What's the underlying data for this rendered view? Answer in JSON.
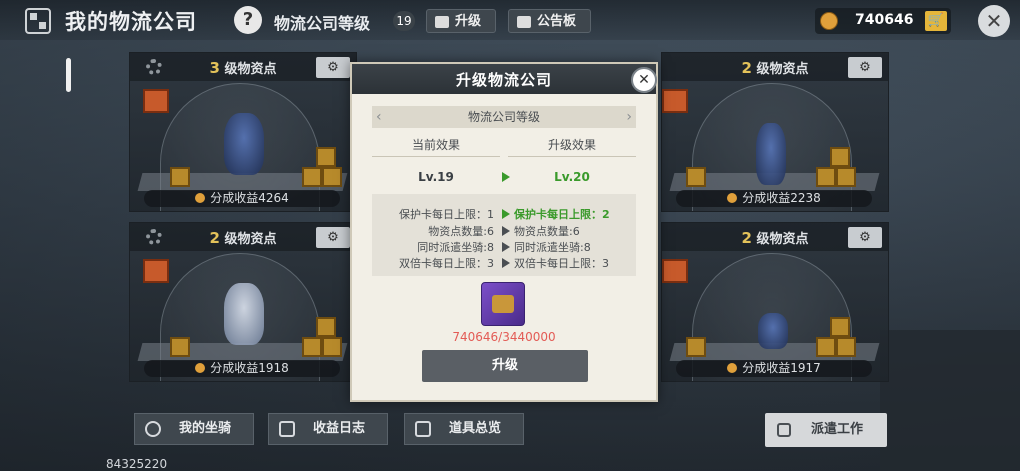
{
  "header": {
    "title": "我的物流公司",
    "help_label": "?",
    "level_label": "物流公司等级",
    "level_value": "19",
    "upgrade_label": "升级",
    "notice_label": "公告板",
    "coins": "740646",
    "close_label": "✕"
  },
  "cards": [
    {
      "level_num": "3",
      "title_suffix": "级物资点",
      "income": "分成收益4264"
    },
    {
      "level_num": "2",
      "title_suffix": "级物资点",
      "income": "分成收益2238"
    },
    {
      "level_num": "2",
      "title_suffix": "级物资点",
      "income": "分成收益1918"
    },
    {
      "level_num": "2",
      "title_suffix": "级物资点",
      "income": "分成收益1917"
    }
  ],
  "bottom": {
    "my_mounts": "我的坐骑",
    "income_log": "收益日志",
    "items_overview": "道具总览",
    "dispatch": "派遣工作",
    "uid": "84325220"
  },
  "modal": {
    "title": "升级物流公司",
    "close_label": "✕",
    "section": "物流公司等级",
    "current_header": "当前效果",
    "upgrade_header": "升级效果",
    "current_level": "Lv.19",
    "next_level": "Lv.20",
    "rows": [
      {
        "left": "保护卡每日上限：1",
        "right": "保护卡每日上限：2",
        "highlight": true
      },
      {
        "left": "物资点数量:6",
        "right": "物资点数量:6",
        "highlight": false
      },
      {
        "left": "同时派遣坐骑:8",
        "right": "同时派遣坐骑:8",
        "highlight": false
      },
      {
        "left": "双倍卡每日上限：3",
        "right": "双倍卡每日上限：3",
        "highlight": false
      }
    ],
    "cost": "740646/3440000",
    "button": "升级"
  },
  "colors": {
    "accent_green": "#3a9a2b",
    "cost_red": "#e35b55",
    "coin_gold": "#e0a03b"
  }
}
